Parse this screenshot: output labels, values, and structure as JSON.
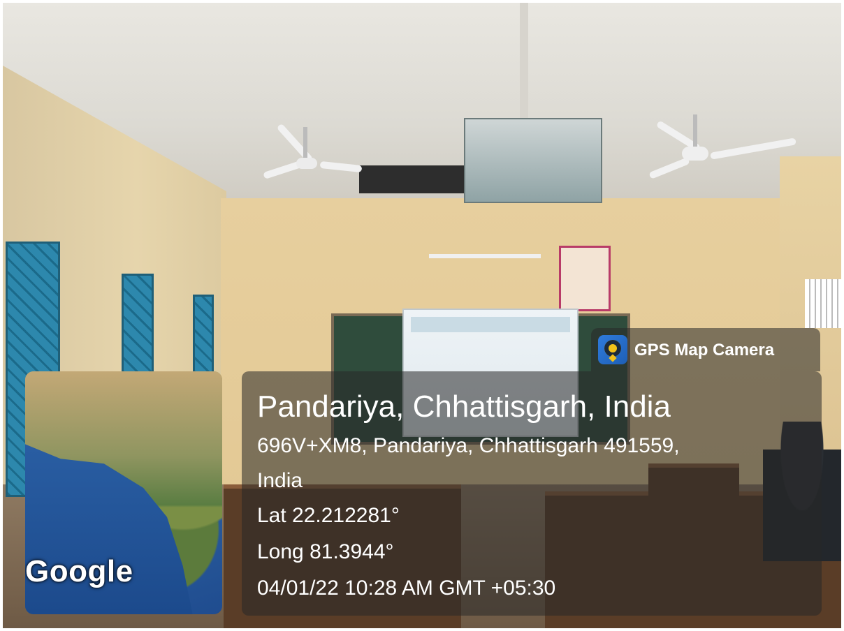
{
  "watermark": {
    "app_name": "GPS Map Camera",
    "app_icon": "gps-map-camera-icon",
    "map_label": "Google",
    "location_title": "Pandariya, Chhattisgarh, India",
    "address_line1": "696V+XM8, Pandariya, Chhattisgarh 491559,",
    "address_line2": "India",
    "latitude": "Lat 22.212281°",
    "longitude": "Long 81.3944°",
    "datetime": "04/01/22 10:28 AM GMT +05:30"
  },
  "colors": {
    "overlay": "#282828",
    "text": "#ffffff"
  }
}
